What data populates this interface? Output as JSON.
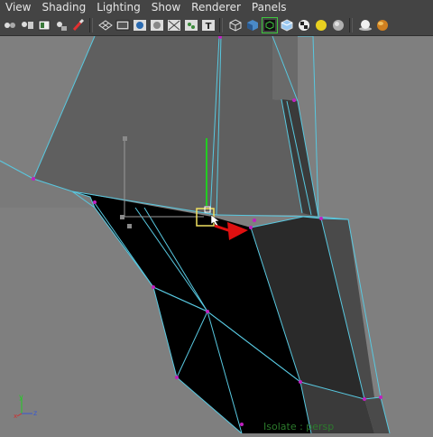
{
  "menubar": {
    "items": [
      "View",
      "Shading",
      "Lighting",
      "Show",
      "Renderer",
      "Panels"
    ]
  },
  "toolbar": {
    "icons": [
      "camera-attributes-icon",
      "camera-bookmark-icon",
      "image-plane-icon",
      "two-d-pan-icon",
      "grease-pencil-icon",
      "grid-icon",
      "film-gate-icon",
      "resolution-gate-icon",
      "gate-mask-icon",
      "field-chart-icon",
      "safe-action-icon",
      "safe-title-icon",
      "wireframe-icon",
      "smooth-shade-icon",
      "wireframe-on-shaded-icon",
      "x-ray-icon",
      "textured-icon",
      "use-lights-icon",
      "shadows-icon",
      "ambient-occlusion-icon",
      "motion-blur-icon"
    ]
  },
  "viewport": {
    "status_text": "Isolate : persp",
    "axis_labels": {
      "x": "x",
      "y": "y",
      "z": "z"
    }
  },
  "colors": {
    "viewport_bg": "#7f7f7f",
    "wireframe": "#58c8e0",
    "vertex": "#c020c0",
    "selected_face": "#000000",
    "manipulator_y": "#22cc22",
    "arrow": "#e01010"
  }
}
